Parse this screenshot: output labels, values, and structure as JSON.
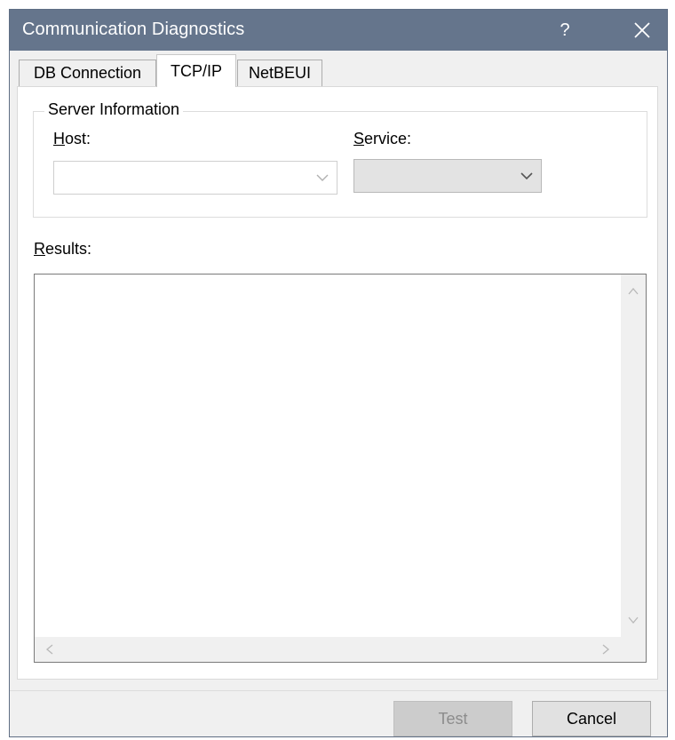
{
  "window": {
    "title": "Communication Diagnostics",
    "help_glyph": "?",
    "colors": {
      "titlebar": "#65758c",
      "face": "#f0f0f0"
    }
  },
  "tabs": [
    {
      "label": "DB Connection",
      "active": false
    },
    {
      "label": "TCP/IP",
      "active": true
    },
    {
      "label": "NetBEUI",
      "active": false
    }
  ],
  "server_info": {
    "legend": "Server Information",
    "host": {
      "mnemonic": "H",
      "label_rest": "ost:",
      "value": ""
    },
    "service": {
      "mnemonic": "S",
      "label_rest": "ervice:",
      "value": ""
    }
  },
  "results": {
    "mnemonic": "R",
    "label_rest": "esults:",
    "content": ""
  },
  "buttons": {
    "test_label": "Test",
    "cancel_label": "Cancel"
  },
  "icons": {
    "close": "close-icon",
    "combo_arrow": "chevron-down-icon",
    "scroll_up": "chevron-up-icon",
    "scroll_down": "chevron-down-icon",
    "scroll_left": "chevron-left-icon",
    "scroll_right": "chevron-right-icon"
  }
}
